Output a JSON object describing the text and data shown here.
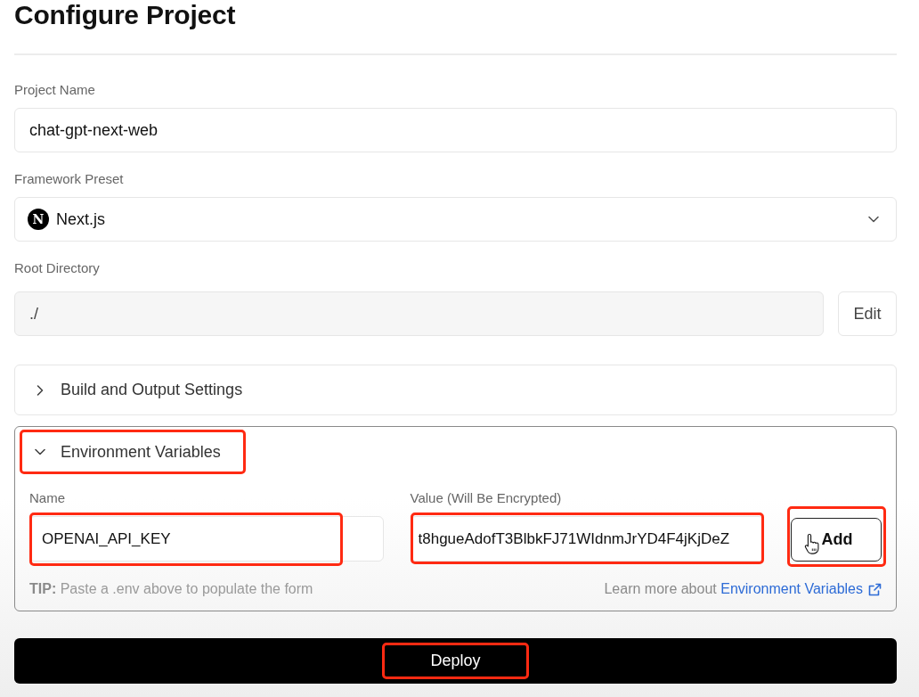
{
  "page": {
    "title": "Configure Project"
  },
  "fields": [
    {
      "kind": "text",
      "label": "Project Name",
      "value": "chat-gpt-next-web"
    },
    {
      "kind": "select",
      "label": "Framework Preset",
      "logo_text": "N",
      "value": "Next.js"
    },
    {
      "kind": "readonly",
      "label": "Root Directory",
      "value": "./",
      "button": "Edit"
    }
  ],
  "sections": [
    {
      "title": "Build and Output Settings",
      "expanded": false,
      "highlighted": false
    },
    {
      "title": "Environment Variables",
      "expanded": true,
      "highlighted": true,
      "name_field": {
        "label": "Name",
        "value": "OPENAI_API_KEY",
        "highlighted": true
      },
      "value_field": {
        "label": "Value (Will Be Encrypted)",
        "value": "t8hgueAdofT3BlbkFJ71WIdnmJrYD4F4jKjDeZ",
        "highlighted": true
      },
      "add_button": {
        "label": "Add",
        "highlighted": true
      },
      "tip": "**TIP:** Paste a .env above to populate the form",
      "learn_more": {
        "text": "Learn more about",
        "link": "Environment Variables"
      }
    }
  ],
  "deploy_button": {
    "label": "Deploy",
    "highlighted": true
  }
}
